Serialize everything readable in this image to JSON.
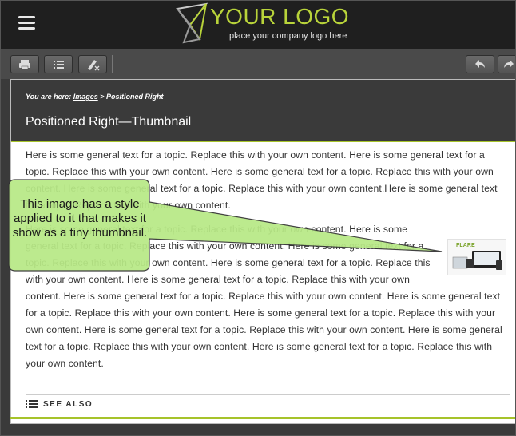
{
  "header": {
    "logo_title": "YOUR LOGO",
    "logo_subtitle": "place your company logo here"
  },
  "toolbar": {
    "buttons": [
      "print-icon",
      "list-icon",
      "clear-highlight-icon",
      "back-icon",
      "forward-icon"
    ]
  },
  "breadcrumb": {
    "prefix": "You are here:",
    "link": "Images",
    "separator": ">",
    "current": "Positioned Right"
  },
  "page": {
    "title": "Positioned Right—Thumbnail",
    "paragraph1": "Here is some general text for a topic. Replace this with your own content. Here is some general text for a topic. Replace this with your own content. Here is some general text for a topic. Replace this with your own content. Here is some general text for a topic. Replace this with your own content.Here is some general text for a topic. Replace this with your own content.",
    "paragraph2": "Here is some general text for a topic. Replace this with your own content. Here is some general text for a topic. Replace this with your own content. Here is some general text for a topic. Replace this with your own content. Here is some general text for a topic. Replace this with your own content. Here is some general text for a topic. Replace this with your own content. Here is some general text for a topic. Replace this with your own content. Here is some general text for a topic. Replace this with your own content. Here is some general text for a topic. Replace this with your own content. Here is some general text for a topic. Replace this with your own content. Here is some general text for a topic. Replace this with your own content. Here is some general text for a topic. Replace this with your own content.",
    "thumbnail_label": "FLARE",
    "see_also": "SEE ALSO"
  },
  "callout": {
    "text": "This image has a style applied to it that makes it show as a tiny thumbnail."
  },
  "colors": {
    "accent": "#a6c32a",
    "header_bg": "#1f1f1f",
    "callout_fill": "#b8e986"
  }
}
